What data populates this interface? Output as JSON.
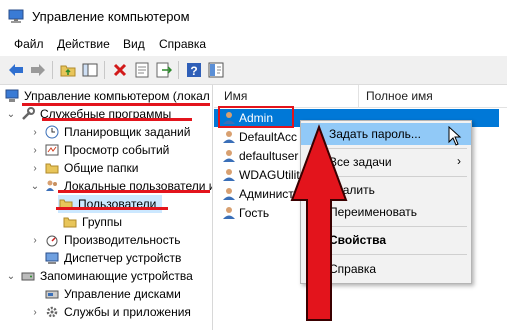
{
  "window": {
    "title": "Управление компьютером"
  },
  "menu": [
    "Файл",
    "Действие",
    "Вид",
    "Справка"
  ],
  "toolbar": {
    "icons": [
      "back-arrow-icon",
      "forward-arrow-icon",
      "folder-up-icon",
      "show-hide-tree-icon",
      "delete-icon",
      "properties-icon",
      "export-icon",
      "help-icon",
      "help-book-icon"
    ]
  },
  "tree": {
    "root": "Управление компьютером (локал",
    "system_tools": "Служебные программы",
    "task_scheduler": "Планировщик заданий",
    "event_viewer": "Просмотр событий",
    "shared_folders": "Общие папки",
    "local_users": "Локальные пользователи и",
    "users": "Пользователи",
    "groups": "Группы",
    "performance": "Производительность",
    "device_manager": "Диспетчер устройств",
    "storage": "Запоминающие устройства",
    "disk_management": "Управление дисками",
    "services": "Службы и приложения"
  },
  "list": {
    "columns": [
      "Имя",
      "Полное имя"
    ],
    "rows": [
      "Admin",
      "DefaultAcc",
      "defaultuser",
      "WDAGUtilit",
      "Администр",
      "Гость"
    ]
  },
  "context_menu": {
    "set_password": "Задать пароль...",
    "all_tasks": "Все задачи",
    "delete": "Удалить",
    "rename": "Переименовать",
    "properties": "Свойства",
    "help": "Справка"
  },
  "colors": {
    "annotation_red": "#e3141c",
    "selection_blue": "#0078d7",
    "menu_highlight": "#91c9f7"
  }
}
